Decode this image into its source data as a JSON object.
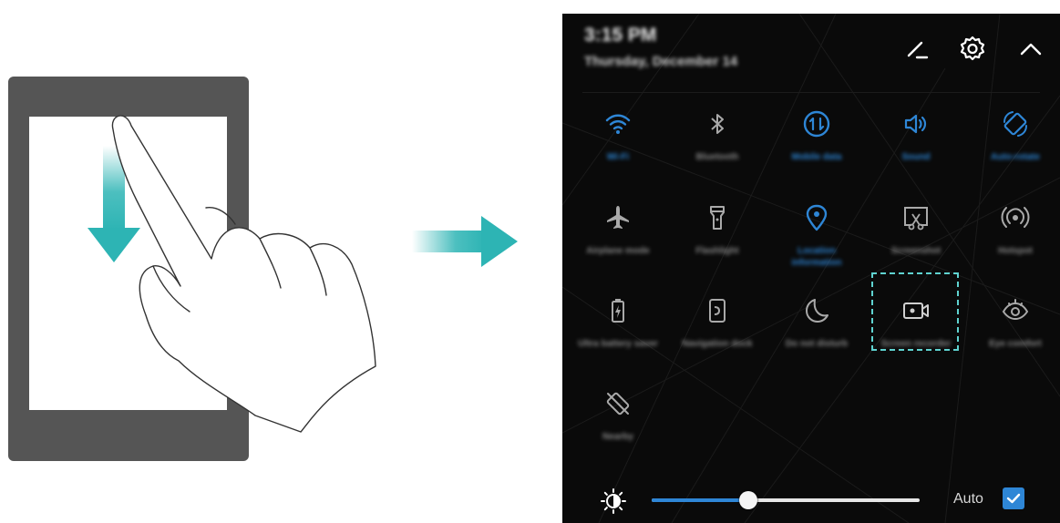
{
  "status": {
    "time": "3:15 PM",
    "date": "Thursday, December 14"
  },
  "header_icons": [
    "edit-icon",
    "settings-gear-icon",
    "collapse-chevron-up-icon"
  ],
  "tiles": [
    {
      "label": "Wi-Fi",
      "icon": "wifi-icon",
      "active": true
    },
    {
      "label": "Bluetooth",
      "icon": "bluetooth-icon",
      "active": false
    },
    {
      "label": "Mobile data",
      "icon": "mobile-data-icon",
      "active": true
    },
    {
      "label": "Sound",
      "icon": "sound-icon",
      "active": true
    },
    {
      "label": "Auto-rotate",
      "icon": "auto-rotate-icon",
      "active": true
    },
    {
      "label": "Airplane mode",
      "icon": "airplane-icon",
      "active": false
    },
    {
      "label": "Flashlight",
      "icon": "flashlight-icon",
      "active": false
    },
    {
      "label": "Location information",
      "icon": "location-icon",
      "active": true
    },
    {
      "label": "Screenshot",
      "icon": "screenshot-icon",
      "active": false
    },
    {
      "label": "Hotspot",
      "icon": "hotspot-icon",
      "active": false
    },
    {
      "label": "Ultra battery saver",
      "icon": "battery-icon",
      "active": false
    },
    {
      "label": "Navigation dock",
      "icon": "navigation-dock-icon",
      "active": false
    },
    {
      "label": "Do not disturb",
      "icon": "moon-icon",
      "active": false
    },
    {
      "label": "Screen recorder",
      "icon": "screen-recorder-icon",
      "active": false
    },
    {
      "label": "Eye comfort",
      "icon": "eye-icon",
      "active": false
    },
    {
      "label": "Nearby",
      "icon": "nearby-icon",
      "active": false
    }
  ],
  "brightness": {
    "level": 0.36,
    "auto_label": "Auto",
    "auto_checked": true
  },
  "colors": {
    "active": "#2e86d6",
    "inactive": "#a9a9a9",
    "highlight": "#5fd3d0",
    "arrow": "#2db4b4",
    "phone_frame": "#555555"
  }
}
